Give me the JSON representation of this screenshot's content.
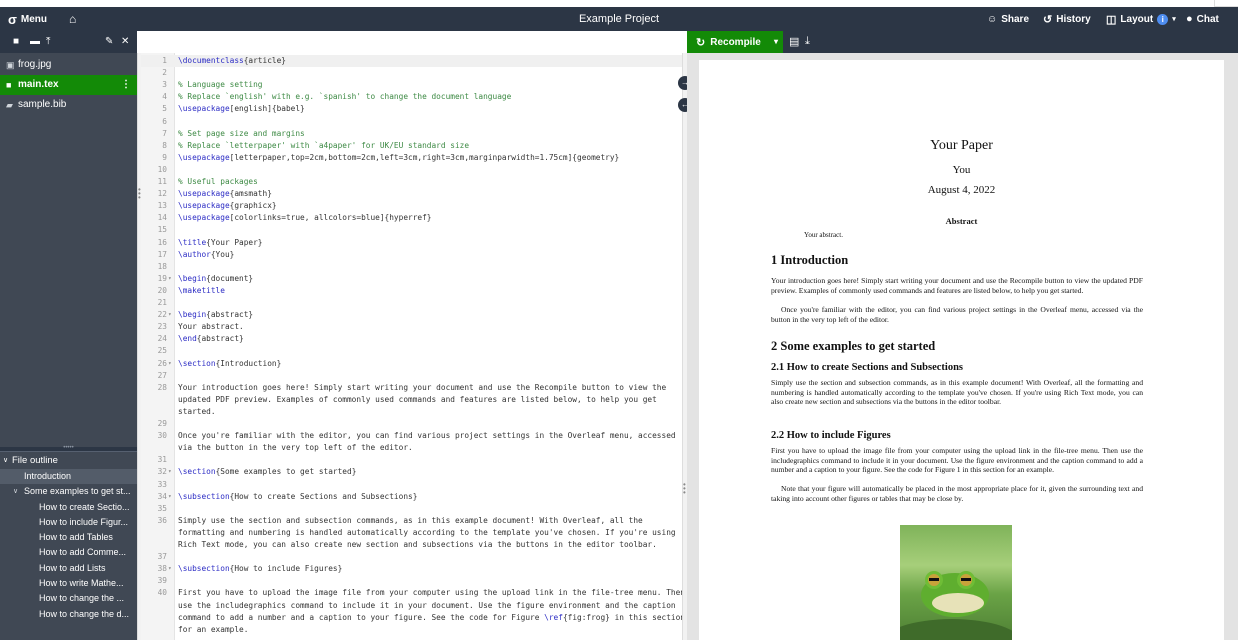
{
  "topbar": {
    "menu_label": "Menu",
    "title": "Example Project",
    "share_label": "Share",
    "history_label": "History",
    "layout_label": "Layout",
    "layout_badge": "i",
    "chat_label": "Chat"
  },
  "filetree": {
    "files": [
      {
        "name": "frog.jpg",
        "icon": "image-icon"
      },
      {
        "name": "main.tex",
        "icon": "file-icon",
        "active": true
      },
      {
        "name": "sample.bib",
        "icon": "bib-icon"
      }
    ]
  },
  "outline": {
    "header": "File outline",
    "items": [
      {
        "label": "Introduction",
        "level": 1
      },
      {
        "label": "Some examples to get st...",
        "level": 1
      },
      {
        "label": "How to create Sectio...",
        "level": 2
      },
      {
        "label": "How to include Figur...",
        "level": 2
      },
      {
        "label": "How to add Tables",
        "level": 2
      },
      {
        "label": "How to add Comme...",
        "level": 2
      },
      {
        "label": "How to add Lists",
        "level": 2
      },
      {
        "label": "How to write Mathe...",
        "level": 2
      },
      {
        "label": "How to change the ...",
        "level": 2
      },
      {
        "label": "How to change the d...",
        "level": 2
      }
    ]
  },
  "editor": {
    "lines": [
      {
        "n": "1",
        "text": "\\documentclass{article}"
      },
      {
        "n": "2",
        "text": ""
      },
      {
        "n": "3",
        "text": "% Language setting"
      },
      {
        "n": "4",
        "text": "% Replace `english' with e.g. `spanish' to change the document language"
      },
      {
        "n": "5",
        "text": "\\usepackage[english]{babel}"
      },
      {
        "n": "6",
        "text": ""
      },
      {
        "n": "7",
        "text": "% Set page size and margins"
      },
      {
        "n": "8",
        "text": "% Replace `letterpaper' with `a4paper' for UK/EU standard size"
      },
      {
        "n": "9",
        "text": "\\usepackage[letterpaper,top=2cm,bottom=2cm,left=3cm,right=3cm,marginparwidth=1.75cm]{geometry}"
      },
      {
        "n": "10",
        "text": ""
      },
      {
        "n": "11",
        "text": "% Useful packages"
      },
      {
        "n": "12",
        "text": "\\usepackage{amsmath}"
      },
      {
        "n": "13",
        "text": "\\usepackage{graphicx}"
      },
      {
        "n": "14",
        "text": "\\usepackage[colorlinks=true, allcolors=blue]{hyperref}"
      },
      {
        "n": "15",
        "text": ""
      },
      {
        "n": "16",
        "text": "\\title{Your Paper}"
      },
      {
        "n": "17",
        "text": "\\author{You}"
      },
      {
        "n": "18",
        "text": ""
      },
      {
        "n": "19",
        "text": "\\begin{document}",
        "fold": true
      },
      {
        "n": "20",
        "text": "\\maketitle"
      },
      {
        "n": "21",
        "text": ""
      },
      {
        "n": "22",
        "text": "\\begin{abstract}",
        "fold": true
      },
      {
        "n": "23",
        "text": "Your abstract."
      },
      {
        "n": "24",
        "text": "\\end{abstract}"
      },
      {
        "n": "25",
        "text": ""
      },
      {
        "n": "26",
        "text": "\\section{Introduction}",
        "fold": true
      },
      {
        "n": "27",
        "text": ""
      },
      {
        "n": "28",
        "text": "Your introduction goes here! Simply start writing your document and use the Recompile button to view the"
      },
      {
        "n": "",
        "text": "updated PDF preview. Examples of commonly used commands and features are listed below, to help you get"
      },
      {
        "n": "",
        "text": "started."
      },
      {
        "n": "29",
        "text": ""
      },
      {
        "n": "30",
        "text": "Once you're familiar with the editor, you can find various project settings in the Overleaf menu, accessed"
      },
      {
        "n": "",
        "text": "via the button in the very top left of the editor."
      },
      {
        "n": "31",
        "text": ""
      },
      {
        "n": "32",
        "text": "\\section{Some examples to get started}",
        "fold": true
      },
      {
        "n": "33",
        "text": ""
      },
      {
        "n": "34",
        "text": "\\subsection{How to create Sections and Subsections}",
        "fold": true
      },
      {
        "n": "35",
        "text": ""
      },
      {
        "n": "36",
        "text": "Simply use the section and subsection commands, as in this example document! With Overleaf, all the"
      },
      {
        "n": "",
        "text": "formatting and numbering is handled automatically according to the template you've chosen. If you're using"
      },
      {
        "n": "",
        "text": "Rich Text mode, you can also create new section and subsections via the buttons in the editor toolbar."
      },
      {
        "n": "37",
        "text": ""
      },
      {
        "n": "38",
        "text": "\\subsection{How to include Figures}",
        "fold": true
      },
      {
        "n": "39",
        "text": ""
      },
      {
        "n": "40",
        "text": "First you have to upload the image file from your computer using the upload link in the file-tree menu. Then"
      },
      {
        "n": "",
        "text": "use the includegraphics command to include it in your document. Use the figure environment and the caption"
      },
      {
        "n": "",
        "text": "command to add a number and a caption to your figure. See the code for Figure \\ref{fig:frog} in this section"
      },
      {
        "n": "",
        "text": "for an example."
      }
    ]
  },
  "pdf_toolbar": {
    "recompile_label": "Recompile"
  },
  "pdf": {
    "title": "Your Paper",
    "author": "You",
    "date": "August 4, 2022",
    "abstract_heading": "Abstract",
    "abstract_text": "Your abstract.",
    "sec1": "1   Introduction",
    "sec1_p1": "Your introduction goes here! Simply start writing your document and use the Recompile button to view the updated PDF preview. Examples of commonly used commands and features are listed below, to help you get started.",
    "sec1_p2": "Once you're familiar with the editor, you can find various project settings in the Overleaf menu, accessed via the button in the very top left of the editor.",
    "sec2": "2   Some examples to get started",
    "sub21": "2.1   How to create Sections and Subsections",
    "sub21_p": "Simply use the section and subsection commands, as in this example document! With Overleaf, all the formatting and numbering is handled automatically according to the template you've chosen. If you're using Rich Text mode, you can also create new section and subsections via the buttons in the editor toolbar.",
    "sub22": "2.2   How to include Figures",
    "sub22_p1": "First you have to upload the image file from your computer using the upload link in the file-tree menu. Then use the includegraphics command to include it in your document. Use the figure environment and the caption command to add a number and a caption to your figure. See the code for Figure 1 in this section for an example.",
    "sub22_p2": "Note that your figure will automatically be placed in the most appropriate place for it, given the surrounding text and taking into account other figures or tables that may be close by."
  },
  "colors": {
    "dark": "#2c3645",
    "panel": "#404854",
    "green": "#138a07",
    "info": "#4e8df0"
  }
}
